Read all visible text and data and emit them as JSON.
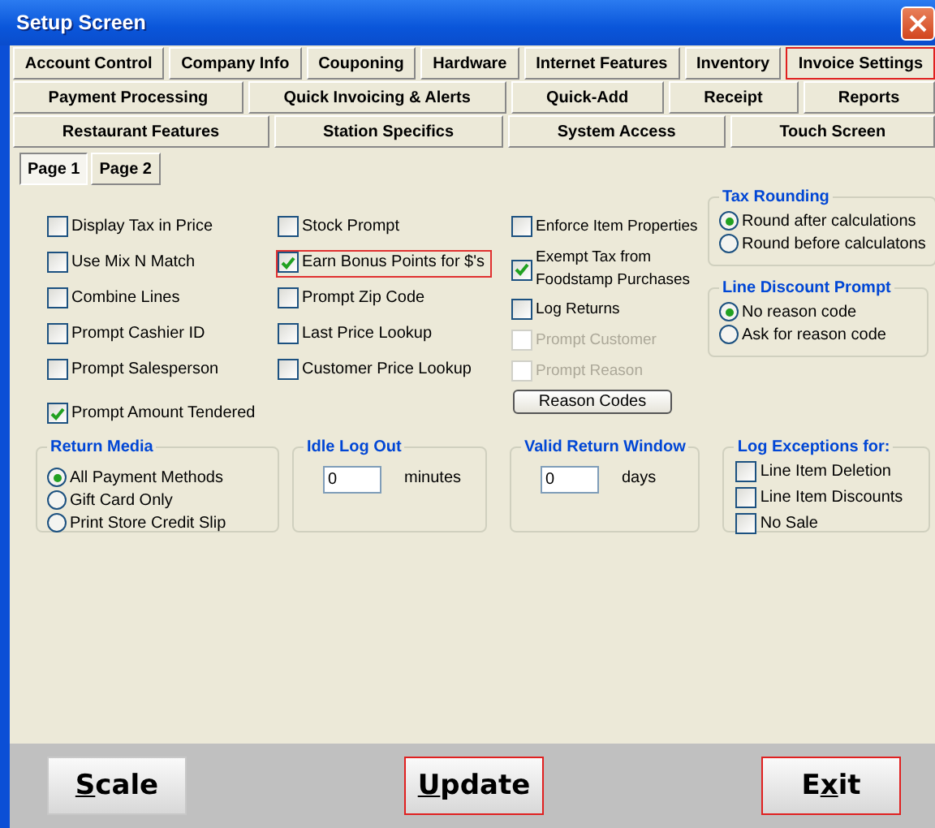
{
  "window": {
    "title": "Setup Screen"
  },
  "tab_rows": [
    [
      {
        "label": "Account Control",
        "selected": false
      },
      {
        "label": "Company Info",
        "selected": false
      },
      {
        "label": "Couponing",
        "selected": false
      },
      {
        "label": "Hardware",
        "selected": false
      },
      {
        "label": "Internet Features",
        "selected": false
      },
      {
        "label": "Inventory",
        "selected": false
      },
      {
        "label": "Invoice Settings",
        "selected": true
      }
    ],
    [
      {
        "label": "Payment Processing",
        "selected": false
      },
      {
        "label": "Quick Invoicing & Alerts",
        "selected": false
      },
      {
        "label": "Quick-Add",
        "selected": false
      },
      {
        "label": "Receipt",
        "selected": false
      },
      {
        "label": "Reports",
        "selected": false
      }
    ],
    [
      {
        "label": "Restaurant Features",
        "selected": false
      },
      {
        "label": "Station Specifics",
        "selected": false
      },
      {
        "label": "System Access",
        "selected": false
      },
      {
        "label": "Touch Screen",
        "selected": false
      }
    ]
  ],
  "pages": [
    {
      "label": "Page 1",
      "selected": true
    },
    {
      "label": "Page 2",
      "selected": false
    }
  ],
  "option_columns": [
    [
      {
        "kind": "checkbox",
        "label": "Display Tax in Price",
        "checked": false,
        "disabled": false,
        "highlighted": false
      },
      {
        "kind": "checkbox",
        "label": "Use Mix N Match",
        "checked": false,
        "disabled": false,
        "highlighted": false
      },
      {
        "kind": "checkbox",
        "label": "Combine Lines",
        "checked": false,
        "disabled": false,
        "highlighted": false
      },
      {
        "kind": "checkbox",
        "label": "Prompt Cashier ID",
        "checked": false,
        "disabled": false,
        "highlighted": false
      },
      {
        "kind": "checkbox",
        "label": "Prompt Salesperson",
        "checked": false,
        "disabled": false,
        "highlighted": false
      },
      {
        "kind": "checkbox",
        "label": "Prompt Amount Tendered",
        "checked": true,
        "disabled": false,
        "highlighted": false
      }
    ],
    [
      {
        "kind": "checkbox",
        "label": "Stock Prompt",
        "checked": false,
        "disabled": false,
        "highlighted": false
      },
      {
        "kind": "checkbox",
        "label": "Earn Bonus Points for $'s",
        "checked": true,
        "disabled": false,
        "highlighted": true
      },
      {
        "kind": "checkbox",
        "label": "Prompt Zip Code",
        "checked": false,
        "disabled": false,
        "highlighted": false
      },
      {
        "kind": "checkbox",
        "label": "Last Price Lookup",
        "checked": false,
        "disabled": false,
        "highlighted": false
      },
      {
        "kind": "checkbox",
        "label": "Customer Price Lookup",
        "checked": false,
        "disabled": false,
        "highlighted": false
      }
    ],
    [
      {
        "kind": "checkbox",
        "label": "Enforce Item Properties",
        "checked": false,
        "disabled": false,
        "highlighted": false
      },
      {
        "kind": "checkbox",
        "label": "Exempt Tax from Foodstamp Purchases",
        "checked": true,
        "disabled": false,
        "highlighted": false
      },
      {
        "kind": "checkbox",
        "label": "Log Returns",
        "checked": false,
        "disabled": false,
        "highlighted": false
      },
      {
        "kind": "checkbox",
        "label": "Prompt Customer",
        "checked": false,
        "disabled": true,
        "highlighted": false
      },
      {
        "kind": "checkbox",
        "label": "Prompt Reason",
        "checked": false,
        "disabled": true,
        "highlighted": false
      },
      {
        "kind": "button",
        "label": "Reason Codes"
      }
    ]
  ],
  "side_groups": [
    {
      "title": "Tax Rounding",
      "options": [
        {
          "label": "Round after calculations",
          "selected": true
        },
        {
          "label": "Round before calculatons",
          "selected": false
        }
      ]
    },
    {
      "title": "Line Discount Prompt",
      "options": [
        {
          "label": "No reason code",
          "selected": true
        },
        {
          "label": "Ask for reason code",
          "selected": false
        }
      ]
    }
  ],
  "bottom_groups": [
    {
      "kind": "radios",
      "title": "Return Media",
      "options": [
        {
          "label": "All Payment Methods",
          "selected": true
        },
        {
          "label": "Gift Card Only",
          "selected": false
        },
        {
          "label": "Print Store Credit Slip",
          "selected": false
        }
      ]
    },
    {
      "kind": "number",
      "title": "Idle Log Out",
      "value": "0",
      "unit": "minutes"
    },
    {
      "kind": "number",
      "title": "Valid Return Window",
      "value": "0",
      "unit": "days"
    },
    {
      "kind": "checks",
      "title": "Log Exceptions for:",
      "options": [
        {
          "label": "Line Item Deletion",
          "checked": false
        },
        {
          "label": "Line Item Discounts",
          "checked": false
        },
        {
          "label": "No Sale",
          "checked": false
        }
      ]
    }
  ],
  "footer_buttons": [
    {
      "highlighted": false,
      "label_parts": [
        {
          "text": "S",
          "underlined": true
        },
        {
          "text": "cale",
          "underlined": false
        }
      ]
    },
    {
      "highlighted": true,
      "label_parts": [
        {
          "text": "U",
          "underlined": true
        },
        {
          "text": "pdate",
          "underlined": false
        }
      ]
    },
    {
      "highlighted": true,
      "label_parts": [
        {
          "text": "E",
          "underlined": false
        },
        {
          "text": "x",
          "underlined": true
        },
        {
          "text": "it",
          "underlined": false
        }
      ]
    }
  ]
}
